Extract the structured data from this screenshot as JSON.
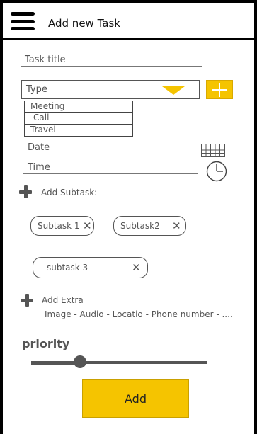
{
  "header": {
    "title": "Add new Task"
  },
  "form": {
    "task_title_placeholder": "Task title",
    "type": {
      "selected": "Type",
      "options": [
        "Meeting",
        "Call",
        "Travel"
      ]
    },
    "date_placeholder": "Date",
    "time_placeholder": "Time",
    "add_subtask_label": "Add Subtask:",
    "subtasks": [
      {
        "label": "Subtask 1",
        "close": "✕"
      },
      {
        "label": "Subtask2",
        "close": "✕"
      },
      {
        "label": "subtask 3",
        "close": "✕"
      }
    ],
    "add_extra_label": "Add Extra",
    "extra_options": "Image - Audio - Locatio  - Phone number - ....",
    "priority_label": "priority",
    "priority_value": 0.28,
    "add_button_label": "Add"
  },
  "colors": {
    "accent": "#f5c400",
    "text": "#555555",
    "border": "#000000"
  }
}
